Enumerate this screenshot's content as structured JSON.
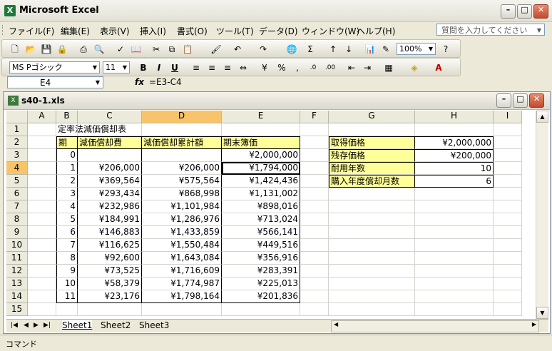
{
  "window": {
    "title": "Microsoft Excel",
    "app_icon": "X"
  },
  "menu": [
    "ファイル(F)",
    "編集(E)",
    "表示(V)",
    "挿入(I)",
    "書式(O)",
    "ツール(T)",
    "データ(D)",
    "ウィンドウ(W)",
    "ヘルプ(H)"
  ],
  "help_placeholder": "質問を入力してください",
  "toolbar": {
    "zoom": "100%",
    "font": "MS Pゴシック",
    "size": "11"
  },
  "formula_bar": {
    "name_box": "E4",
    "fx": "fx",
    "formula": "=E3-C4"
  },
  "workbook": {
    "filename": "s40-1.xls",
    "icon": "X"
  },
  "columns": [
    "A",
    "B",
    "C",
    "D",
    "E",
    "F",
    "G",
    "H",
    "I"
  ],
  "rows": [
    "1",
    "2",
    "3",
    "4",
    "5",
    "6",
    "7",
    "8",
    "9",
    "10",
    "11",
    "12",
    "13",
    "14",
    "15"
  ],
  "sheet": {
    "title": "定率法減価償却表",
    "headers": {
      "period": "期",
      "depreciation": "減価償却費",
      "cumulative": "減価償却累計額",
      "book_value": "期末簿価"
    },
    "table": [
      {
        "period": "0",
        "dep": "",
        "cum": "",
        "book": "¥2,000,000"
      },
      {
        "period": "1",
        "dep": "¥206,000",
        "cum": "¥206,000",
        "book": "¥1,794,000"
      },
      {
        "period": "2",
        "dep": "¥369,564",
        "cum": "¥575,564",
        "book": "¥1,424,436"
      },
      {
        "period": "3",
        "dep": "¥293,434",
        "cum": "¥868,998",
        "book": "¥1,131,002"
      },
      {
        "period": "4",
        "dep": "¥232,986",
        "cum": "¥1,101,984",
        "book": "¥898,016"
      },
      {
        "period": "5",
        "dep": "¥184,991",
        "cum": "¥1,286,976",
        "book": "¥713,024"
      },
      {
        "period": "6",
        "dep": "¥146,883",
        "cum": "¥1,433,859",
        "book": "¥566,141"
      },
      {
        "period": "7",
        "dep": "¥116,625",
        "cum": "¥1,550,484",
        "book": "¥449,516"
      },
      {
        "period": "8",
        "dep": "¥92,600",
        "cum": "¥1,643,084",
        "book": "¥356,916"
      },
      {
        "period": "9",
        "dep": "¥73,525",
        "cum": "¥1,716,609",
        "book": "¥283,391"
      },
      {
        "period": "10",
        "dep": "¥58,379",
        "cum": "¥1,774,987",
        "book": "¥225,013"
      },
      {
        "period": "11",
        "dep": "¥23,176",
        "cum": "¥1,798,164",
        "book": "¥201,836"
      }
    ],
    "params": [
      {
        "label": "取得価格",
        "value": "¥2,000,000"
      },
      {
        "label": "残存価格",
        "value": "¥200,000"
      },
      {
        "label": "耐用年数",
        "value": "10"
      },
      {
        "label": "購入年度償却月数",
        "value": "6"
      }
    ]
  },
  "tabs": [
    "Sheet1",
    "Sheet2",
    "Sheet3"
  ],
  "status": "コマンド"
}
